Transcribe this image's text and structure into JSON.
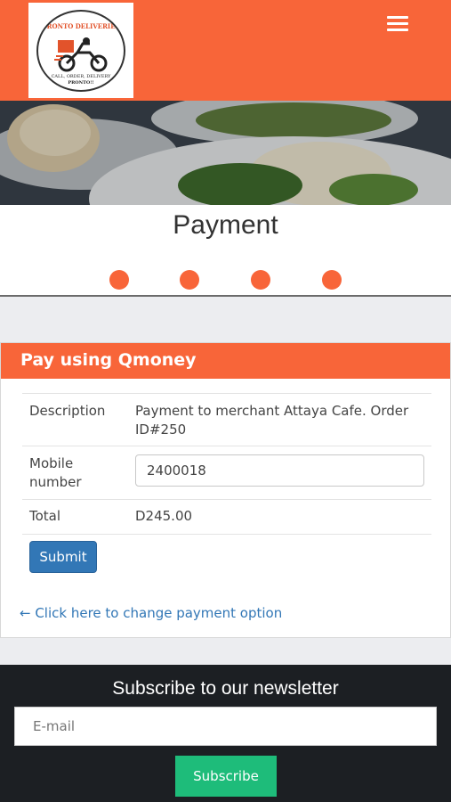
{
  "header": {
    "logo": {
      "line1": "PRONTO DELIVERIES",
      "line2": "CALL, ORDER, DELIVERY",
      "line3": "PRONTO!!"
    },
    "menu_icon": "hamburger-menu-icon",
    "accent_color": "#f86539"
  },
  "hero": {
    "image": "food-plate-photo"
  },
  "page": {
    "title": "Payment",
    "steps": 4
  },
  "payment": {
    "heading": "Pay using Qmoney",
    "description_label": "Description",
    "description_value": "Payment to merchant Attaya Cafe. Order ID#250",
    "mobile_label_1": "Mobile",
    "mobile_label_2": "number",
    "mobile_value": "2400018",
    "total_label": "Total",
    "total_value": "D245.00",
    "submit_label": "Submit",
    "change_link": "← Click here to change payment option",
    "button_color": "#3277b6"
  },
  "newsletter": {
    "title": "Subscribe to our newsletter",
    "email_placeholder": "E-mail",
    "subscribe_label": "Subscribe",
    "button_color": "#1ebc7a"
  }
}
